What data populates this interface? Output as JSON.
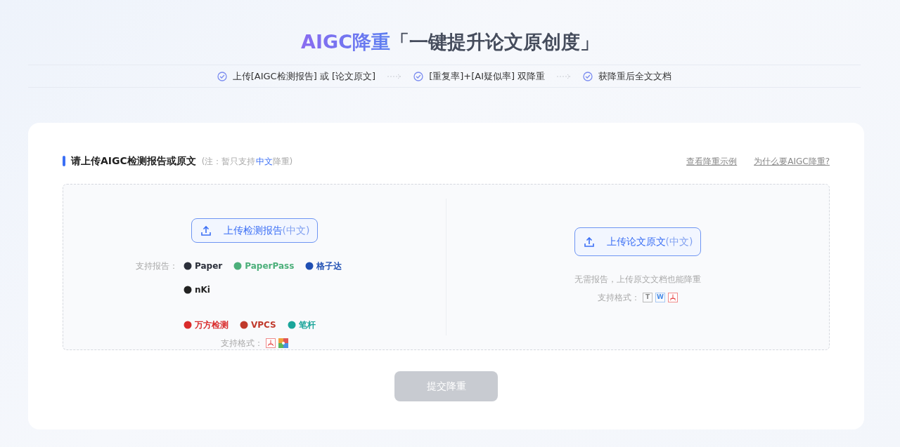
{
  "header": {
    "title_highlight": "AIGC降重",
    "title_rest": "「一键提升论文原创度」"
  },
  "steps": [
    {
      "text": "上传[AIGC检测报告] 或 [论文原文]",
      "checked": true
    },
    {
      "text": "[重复率]+[AI疑似率] 双降重",
      "checked": true
    },
    {
      "text": "获降重后全文文档",
      "checked": true
    }
  ],
  "section": {
    "heading": "请上传AIGC检测报告或原文",
    "note_before": "(注：暂只支持",
    "note_highlight": "中文",
    "note_after": "降重)",
    "links": [
      "查看降重示例",
      "为什么要AIGC降重?"
    ]
  },
  "report_panel": {
    "button": {
      "label": "上传检测报告",
      "suffix": "(中文)"
    },
    "support_label": "支持报告：",
    "logos": [
      {
        "text": "Paper",
        "color": "#2b2f3a"
      },
      {
        "text": "PaperPass",
        "color": "#4caf7a"
      },
      {
        "text": "格子达",
        "color": "#1f4fb3"
      },
      {
        "text": "nKi",
        "color": "#222222"
      },
      {
        "text": "万方检测",
        "color": "#d92b2b"
      },
      {
        "text": "VPCS",
        "color": "#c0392b"
      },
      {
        "text": "笔杆",
        "color": "#1aa59a"
      }
    ],
    "format_label": "支持格式：",
    "formats": [
      {
        "kind": "pdf"
      },
      {
        "kind": "image"
      }
    ]
  },
  "original_panel": {
    "button": {
      "label": "上传论文原文",
      "suffix": "(中文)"
    },
    "hint": "无需报告，上传原文文档也能降重",
    "format_label": "支持格式：",
    "formats": [
      {
        "kind": "text",
        "text": "T"
      },
      {
        "kind": "word",
        "text": "W"
      },
      {
        "kind": "pdf"
      }
    ]
  },
  "submit": {
    "label": "提交降重",
    "disabled": true
  }
}
